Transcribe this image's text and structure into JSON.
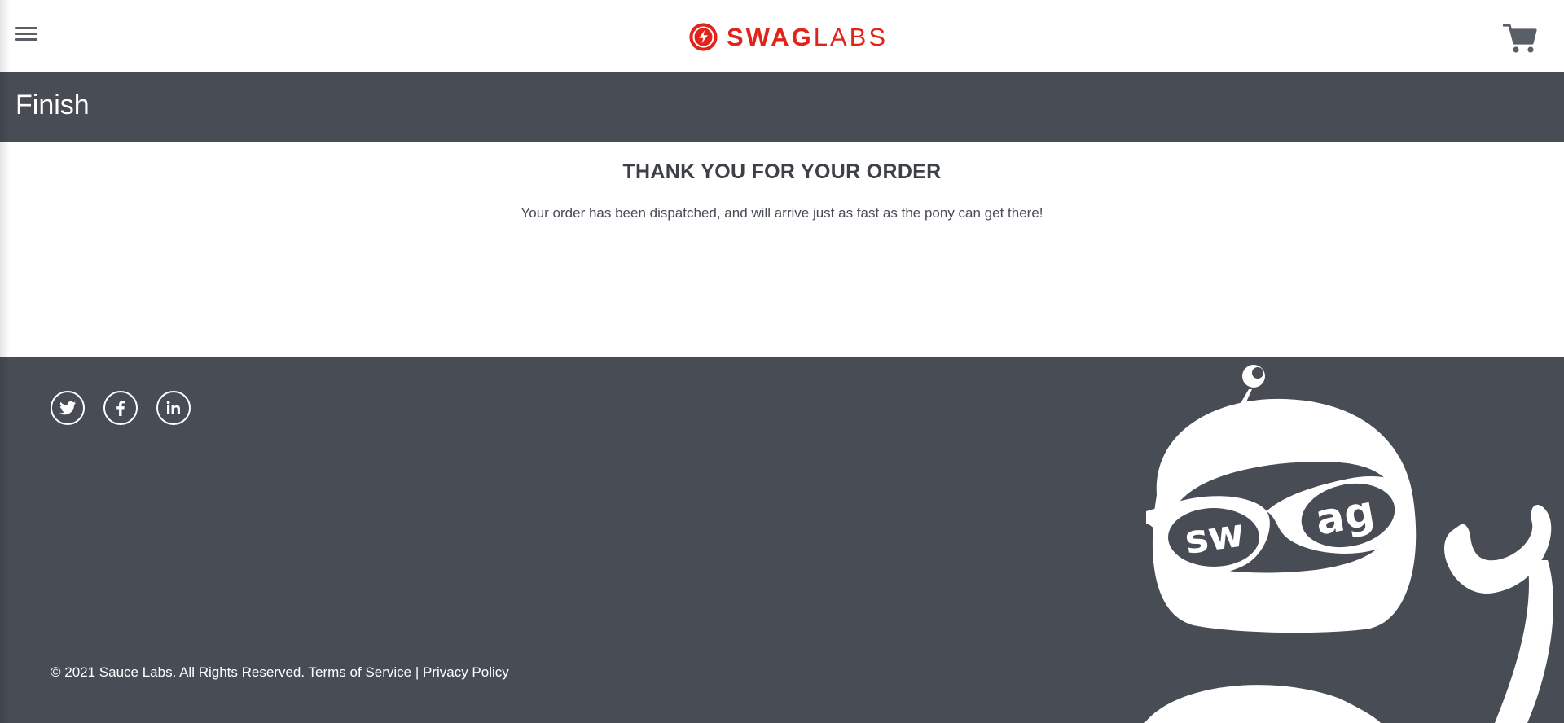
{
  "header": {
    "menu_icon": "hamburger-menu-icon",
    "logo": {
      "word_bold": "SWAG",
      "word_light": "LABS",
      "mark_icon": "swag-labs-logo-mark"
    },
    "cart_icon": "shopping-cart-icon"
  },
  "subheader": {
    "title": "Finish"
  },
  "main": {
    "heading": "THANK YOU FOR YOUR ORDER",
    "message": "Your order has been dispatched, and will arrive just as fast as the pony can get there!"
  },
  "footer": {
    "social": [
      {
        "name": "twitter",
        "icon": "twitter-icon"
      },
      {
        "name": "facebook",
        "icon": "facebook-icon"
      },
      {
        "name": "linkedin",
        "icon": "linkedin-icon"
      }
    ],
    "copyright": "© 2021 Sauce Labs. All Rights Reserved. Terms of Service | Privacy Policy",
    "robot_lettering": "swag"
  },
  "colors": {
    "brand_red": "#e2231a",
    "dark_bar": "#474c55",
    "text": "#484c55"
  }
}
